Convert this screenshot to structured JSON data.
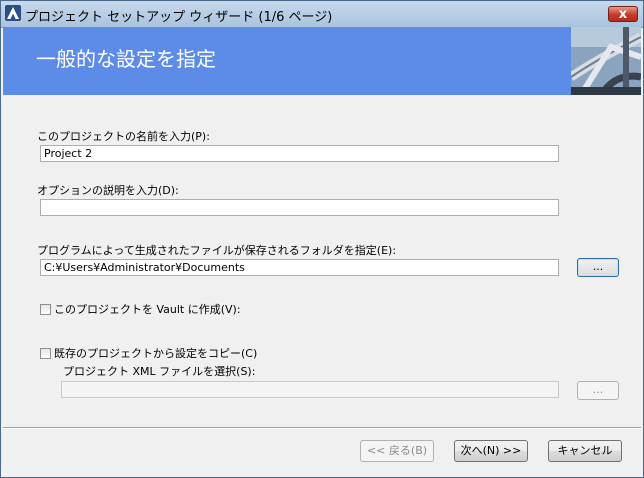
{
  "window": {
    "title": "プロジェクト セットアップ ウィザード (1/6 ページ)",
    "close_label": "x"
  },
  "banner": {
    "title": "一般的な設定を指定",
    "image": "industrial-pipes-image"
  },
  "form": {
    "project_name": {
      "label": "このプロジェクトの名前を入力(P):",
      "value": "Project 2"
    },
    "description": {
      "label": "オプションの説明を入力(D):",
      "value": ""
    },
    "folder": {
      "label": "プログラムによって生成されたファイルが保存されるフォルダを指定(E):",
      "value": "C:¥Users¥Administrator¥Documents",
      "browse_label": "..."
    },
    "vault": {
      "label": "このプロジェクトを Vault に作成(V):",
      "checked": false
    },
    "copy_settings": {
      "label": "既存のプロジェクトから設定をコピー(C)",
      "checked": false
    },
    "xml_file": {
      "label": "プロジェクト XML ファイルを選択(S):",
      "value": "",
      "browse_label": "..."
    }
  },
  "footer": {
    "back_label": "<< 戻る(B)",
    "next_label": "次へ(N) >>",
    "cancel_label": "キャンセル"
  },
  "colors": {
    "banner": "#5c8be8",
    "titlebar": "#b9cfe6",
    "close": "#c5392a"
  }
}
